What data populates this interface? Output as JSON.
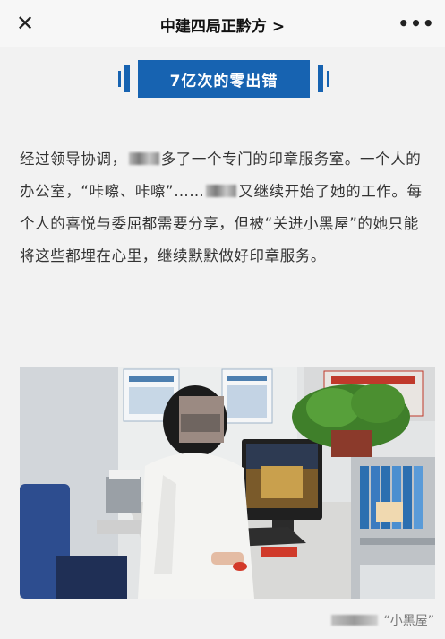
{
  "header": {
    "close_icon": "close-icon",
    "title": "中建四局正黔方 >",
    "more_icon": "more-dots-icon",
    "close_glyph": "✕",
    "more_glyph": "•••"
  },
  "banner": {
    "text": "7亿次的零出错",
    "color": "#1763b1"
  },
  "article": {
    "paragraph": [
      "经过领导协调，",
      "多了一个专门的印章服务室。一个人的办公室，“咔嚓、咔嚓”……",
      "又继续开始了她的工作。每个人的喜悦与委屈都需要分享，但被“关进小黑屋”的她只能将这些都埋在心里，继续默默做好印章服务。"
    ]
  },
  "photo": {
    "caption": "“小黑屋”"
  }
}
